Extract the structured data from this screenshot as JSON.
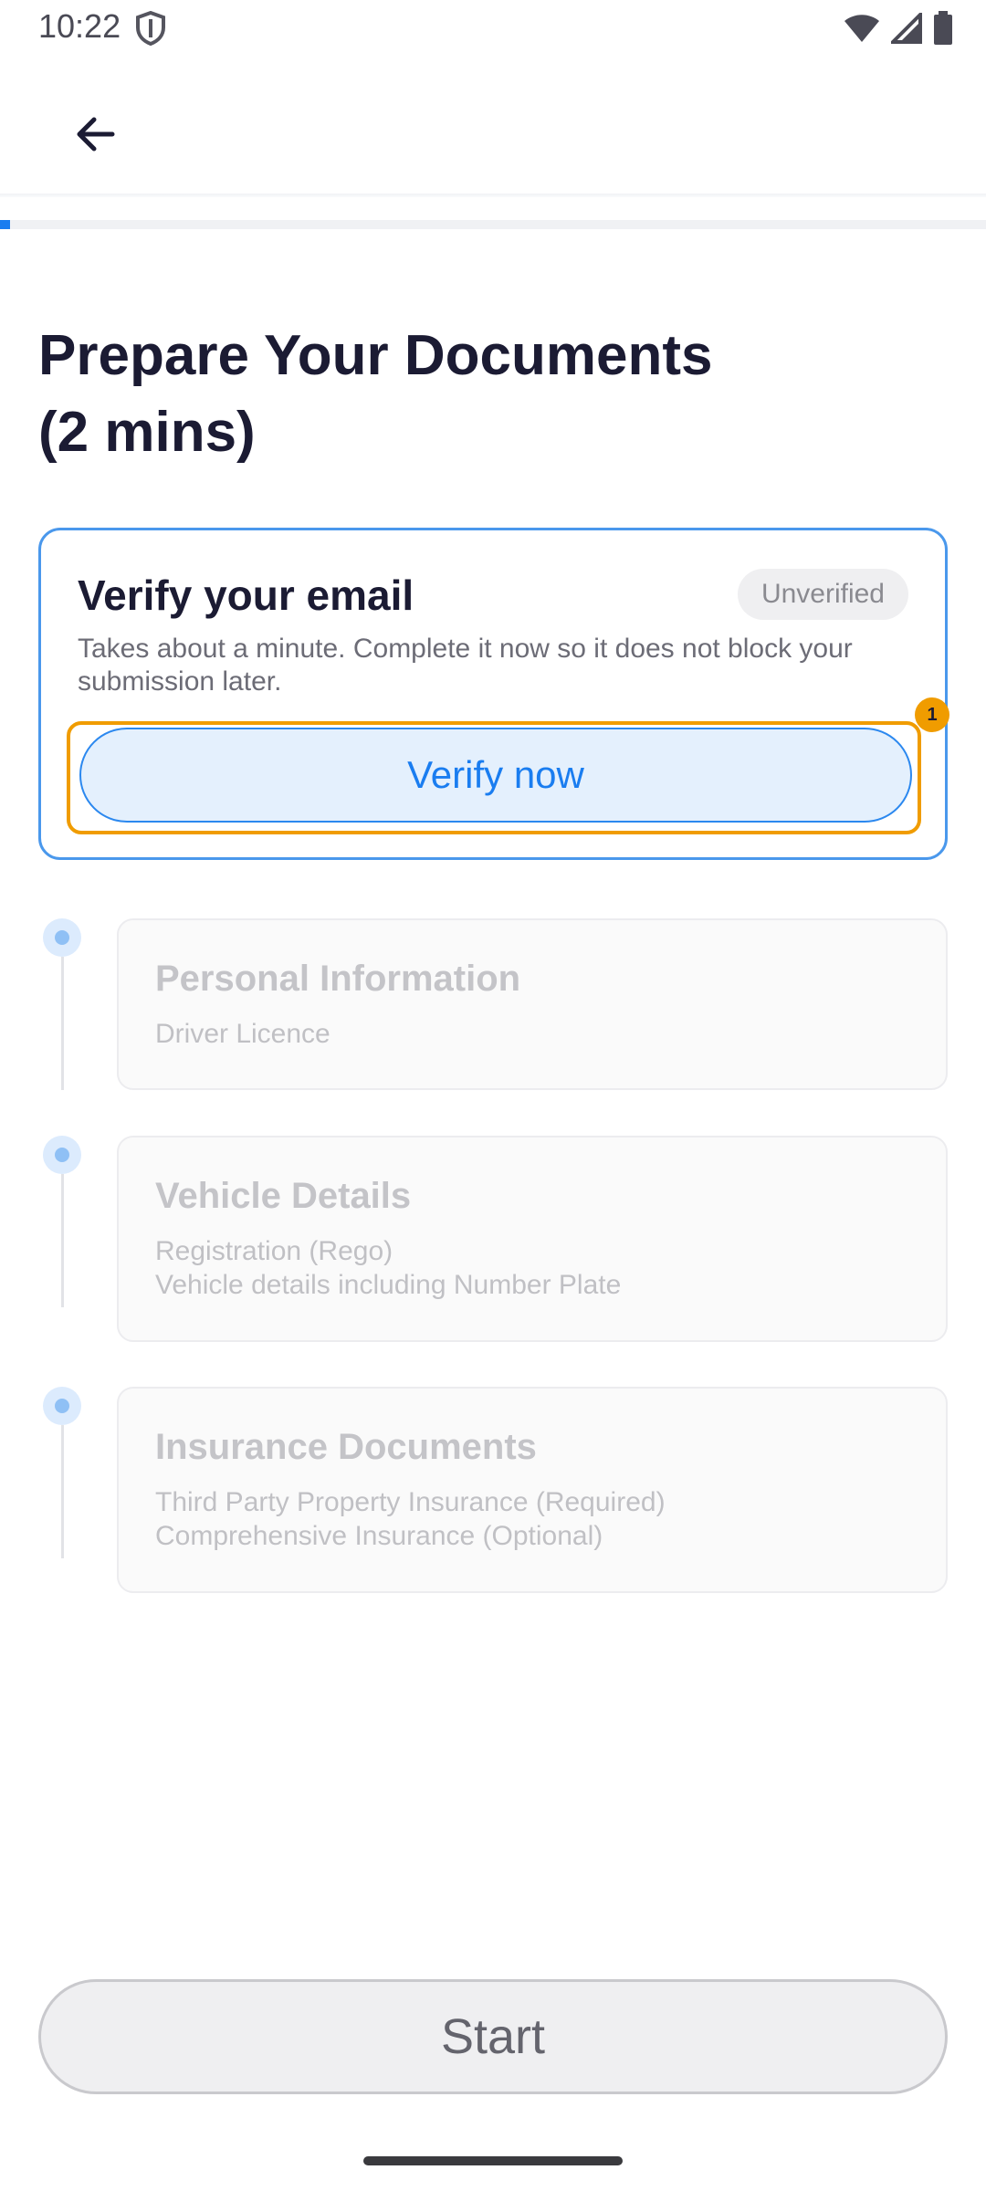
{
  "status_bar": {
    "time": "10:22",
    "icons": [
      "shield-icon",
      "wifi-icon",
      "signal-icon",
      "battery-icon"
    ]
  },
  "app_bar": {
    "back_icon": "arrow-left-icon"
  },
  "progress": {
    "fraction": 0.01,
    "color": "#1a7df0"
  },
  "page": {
    "title": "Prepare Your Documents\n(2 mins)"
  },
  "verify_card": {
    "title": "Verify your email",
    "status": "Unverified",
    "description": "Takes about a minute. Complete it now so it does not block your submission later.",
    "button_label": "Verify now",
    "focus_badge": "1"
  },
  "steps": [
    {
      "title": "Personal Information",
      "lines": [
        "Driver Licence"
      ]
    },
    {
      "title": "Vehicle Details",
      "lines": [
        "Registration (Rego)",
        "Vehicle details including Number Plate"
      ]
    },
    {
      "title": "Insurance Documents",
      "lines": [
        "Third Party Property Insurance (Required)",
        "Comprehensive Insurance (Optional)"
      ]
    }
  ],
  "footer": {
    "start_label": "Start"
  },
  "colors": {
    "accent": "#1a7df0",
    "card_border": "#4a98ec",
    "focus": "#f09c00"
  }
}
